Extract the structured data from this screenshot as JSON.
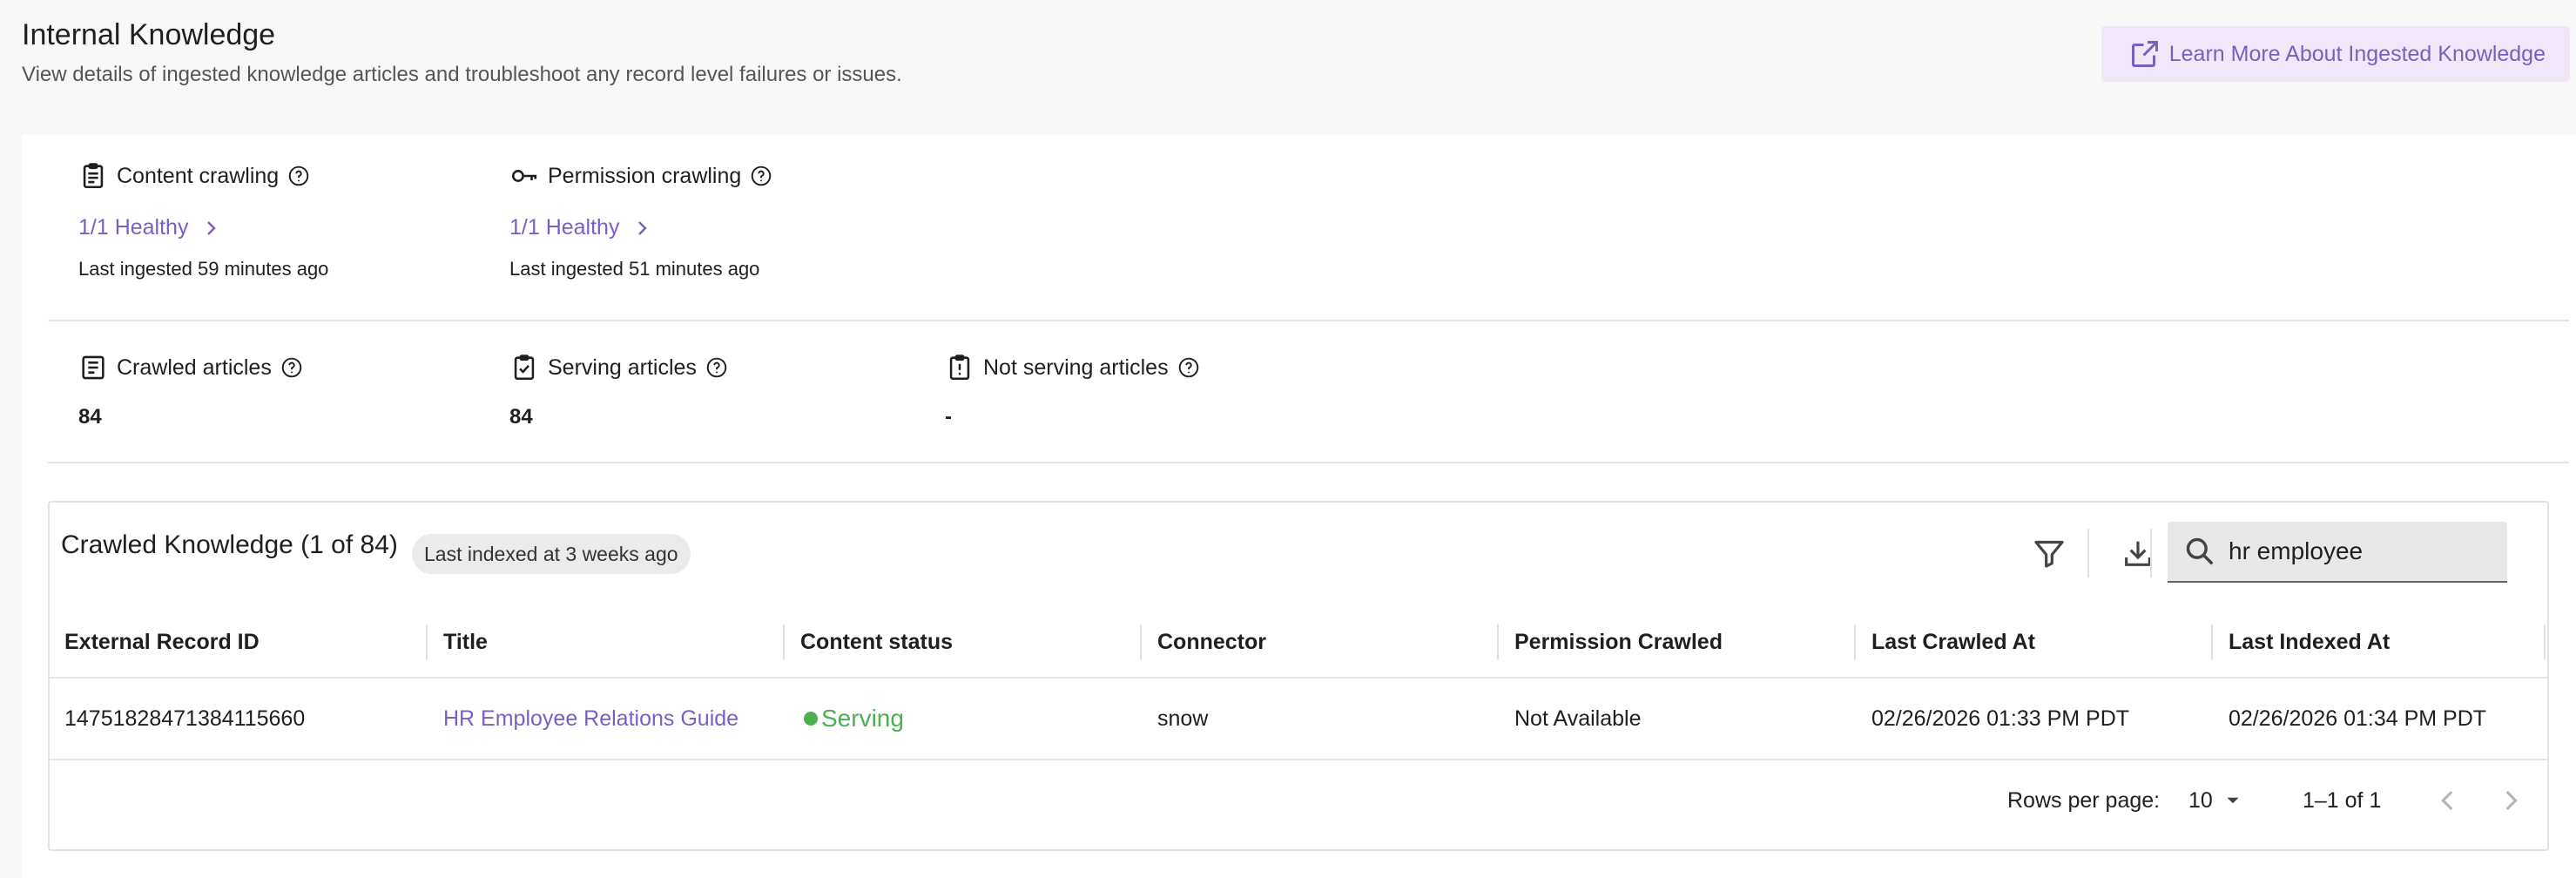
{
  "header": {
    "title": "Internal Knowledge",
    "subtitle": "View details of ingested knowledge articles and troubleshoot any record level failures or issues.",
    "learn_more_label": "Learn More About Ingested Knowledge"
  },
  "crawling": {
    "content": {
      "label": "Content crawling",
      "status": "1/1 Healthy",
      "last_ingested": "Last ingested 59 minutes ago"
    },
    "permission": {
      "label": "Permission crawling",
      "status": "1/1 Healthy",
      "last_ingested": "Last ingested 51 minutes ago"
    }
  },
  "articles": {
    "crawled": {
      "label": "Crawled articles",
      "count": "84"
    },
    "serving": {
      "label": "Serving articles",
      "count": "84"
    },
    "not_serving": {
      "label": "Not serving articles",
      "count": "-"
    }
  },
  "table": {
    "title": "Crawled Knowledge (1 of 84)",
    "badge": "Last indexed at 3 weeks ago",
    "search_value": "hr employee",
    "columns": [
      "External Record ID",
      "Title",
      "Content status",
      "Connector",
      "Permission Crawled",
      "Last Crawled At",
      "Last Indexed At"
    ],
    "rows": [
      {
        "record_id": "14751828471384115660",
        "title": "HR Employee Relations Guide",
        "content_status": "Serving",
        "connector": "snow",
        "permission_crawled": "Not Available",
        "last_crawled": "02/26/2026 01:33 PM PDT",
        "last_indexed": "02/26/2026 01:34 PM PDT"
      }
    ],
    "footer": {
      "rows_per_page_label": "Rows per page:",
      "rows_per_page_value": "10",
      "range": "1–1 of 1"
    }
  },
  "colors": {
    "accent": "#7b5fc0",
    "serving": "#4caf50",
    "learn_bg": "#f0e8f8"
  }
}
